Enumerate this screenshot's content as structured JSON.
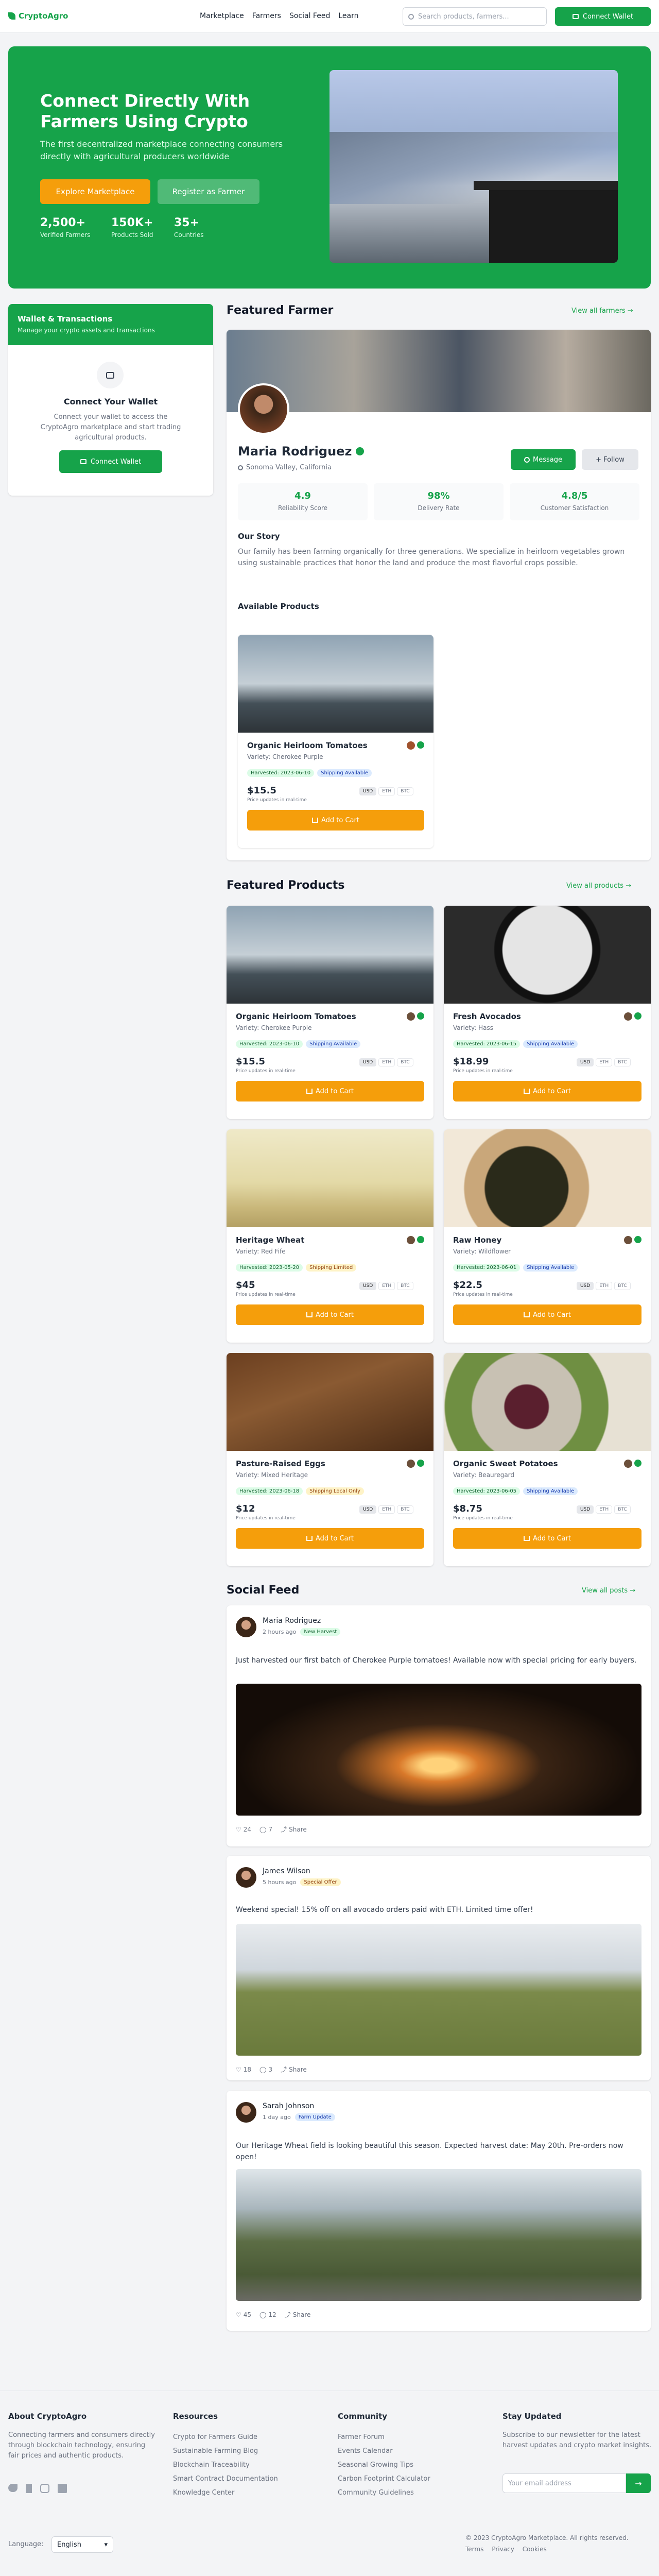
{
  "nav": {
    "brand": "CryptoAgro",
    "items": [
      "Marketplace",
      "Farmers",
      "Social Feed",
      "Learn"
    ],
    "search_placeholder": "Search products, farmers...",
    "connect": "Connect Wallet"
  },
  "hero": {
    "title": "Connect Directly With Farmers Using Crypto",
    "subtitle": "The first decentralized marketplace connecting consumers directly with agricultural producers worldwide",
    "cta1": "Explore Marketplace",
    "cta2": "Register as Farmer",
    "stats": [
      {
        "value": "2,500+",
        "label": "Verified Farmers"
      },
      {
        "value": "150K+",
        "label": "Products Sold"
      },
      {
        "value": "35+",
        "label": "Countries"
      }
    ]
  },
  "wallet": {
    "title": "Wallet & Transactions",
    "subtitle": "Manage your crypto assets and transactions",
    "heading": "Connect Your Wallet",
    "text": "Connect your wallet to access the CryptoAgro marketplace and start trading agricultural products.",
    "button": "Connect Wallet"
  },
  "featured_farmer": {
    "section": "Featured Farmer",
    "view_all": "View all farmers →",
    "name": "Maria Rodriguez",
    "location": "Sonoma Valley, California",
    "message": "Message",
    "follow": "+ Follow",
    "stats": [
      {
        "value": "4.9",
        "label": "Reliability Score"
      },
      {
        "value": "98%",
        "label": "Delivery Rate"
      },
      {
        "value": "4.8/5",
        "label": "Customer Satisfaction"
      }
    ],
    "story_title": "Our Story",
    "story": "Our family has been farming organically for three generations. We specialize in heirloom vegetables grown using sustainable practices that honor the land and produce the most flavorful crops possible.",
    "products_title": "Available Products",
    "product": {
      "name": "Organic Heirloom Tomatoes",
      "variety": "Variety: Cherokee Purple",
      "harvested": "Harvested: 2023-06-10",
      "shipping": "Shipping Available",
      "price": "$15.5",
      "note": "Price updates in real-time",
      "add": "Add to Cart"
    }
  },
  "currencies": [
    "USD",
    "ETH",
    "BTC"
  ],
  "featured_products": {
    "section": "Featured Products",
    "view_all": "View all products →",
    "items": [
      {
        "name": "Organic Heirloom Tomatoes",
        "variety": "Variety: Cherokee Purple",
        "harvested": "Harvested: 2023-06-10",
        "shipping": "Shipping Available",
        "price": "$15.5",
        "note": "Price updates in real-time",
        "add": "Add to Cart",
        "ship_type": "blue"
      },
      {
        "name": "Fresh Avocados",
        "variety": "Variety: Hass",
        "harvested": "Harvested: 2023-06-15",
        "shipping": "Shipping Available",
        "price": "$18.99",
        "note": "Price updates in real-time",
        "add": "Add to Cart",
        "ship_type": "blue"
      },
      {
        "name": "Heritage Wheat",
        "variety": "Variety: Red Fife",
        "harvested": "Harvested: 2023-05-20",
        "shipping": "Shipping Limited",
        "price": "$45",
        "note": "Price updates in real-time",
        "add": "Add to Cart",
        "ship_type": "yellow"
      },
      {
        "name": "Raw Honey",
        "variety": "Variety: Wildflower",
        "harvested": "Harvested: 2023-06-01",
        "shipping": "Shipping Available",
        "price": "$22.5",
        "note": "Price updates in real-time",
        "add": "Add to Cart",
        "ship_type": "blue"
      },
      {
        "name": "Pasture-Raised Eggs",
        "variety": "Variety: Mixed Heritage",
        "harvested": "Harvested: 2023-06-18",
        "shipping": "Shipping Local Only",
        "price": "$12",
        "note": "Price updates in real-time",
        "add": "Add to Cart",
        "ship_type": "yellow"
      },
      {
        "name": "Organic Sweet Potatoes",
        "variety": "Variety: Beauregard",
        "harvested": "Harvested: 2023-06-05",
        "shipping": "Shipping Available",
        "price": "$8.75",
        "note": "Price updates in real-time",
        "add": "Add to Cart",
        "ship_type": "blue"
      }
    ]
  },
  "social": {
    "section": "Social Feed",
    "view_all": "View all posts →",
    "posts": [
      {
        "author": "Maria Rodriguez",
        "time": "2 hours ago",
        "tag": "New Harvest",
        "text": "Just harvested our first batch of Cherokee Purple tomatoes! Available now with special pricing for early buyers.",
        "likes": "24",
        "comments": "7",
        "share": "Share"
      },
      {
        "author": "James Wilson",
        "time": "5 hours ago",
        "tag": "Special Offer",
        "text": "Weekend special! 15% off on all avocado orders paid with ETH. Limited time offer!",
        "likes": "18",
        "comments": "3",
        "share": "Share"
      },
      {
        "author": "Sarah Johnson",
        "time": "1 day ago",
        "tag": "Farm Update",
        "text": "Our Heritage Wheat field is looking beautiful this season. Expected harvest date: May 20th. Pre-orders now open!",
        "likes": "45",
        "comments": "12",
        "share": "Share"
      }
    ]
  },
  "footer": {
    "about_title": "About CryptoAgro",
    "about": "Connecting farmers and consumers directly through blockchain technology, ensuring fair prices and authentic products.",
    "resources_title": "Resources",
    "resources": [
      "Crypto for Farmers Guide",
      "Sustainable Farming Blog",
      "Blockchain Traceability",
      "Smart Contract Documentation",
      "Knowledge Center"
    ],
    "community_title": "Community",
    "community": [
      "Farmer Forum",
      "Events Calendar",
      "Seasonal Growing Tips",
      "Carbon Footprint Calculator",
      "Community Guidelines"
    ],
    "news_title": "Stay Updated",
    "news": "Subscribe to our newsletter for the latest harvest updates and crypto market insights.",
    "email_placeholder": "Your email address",
    "language_label": "Language:",
    "language": "English",
    "copyright": "© 2023 CryptoAgro Marketplace. All rights reserved.",
    "legal": [
      "Terms",
      "Privacy",
      "Cookies"
    ]
  }
}
